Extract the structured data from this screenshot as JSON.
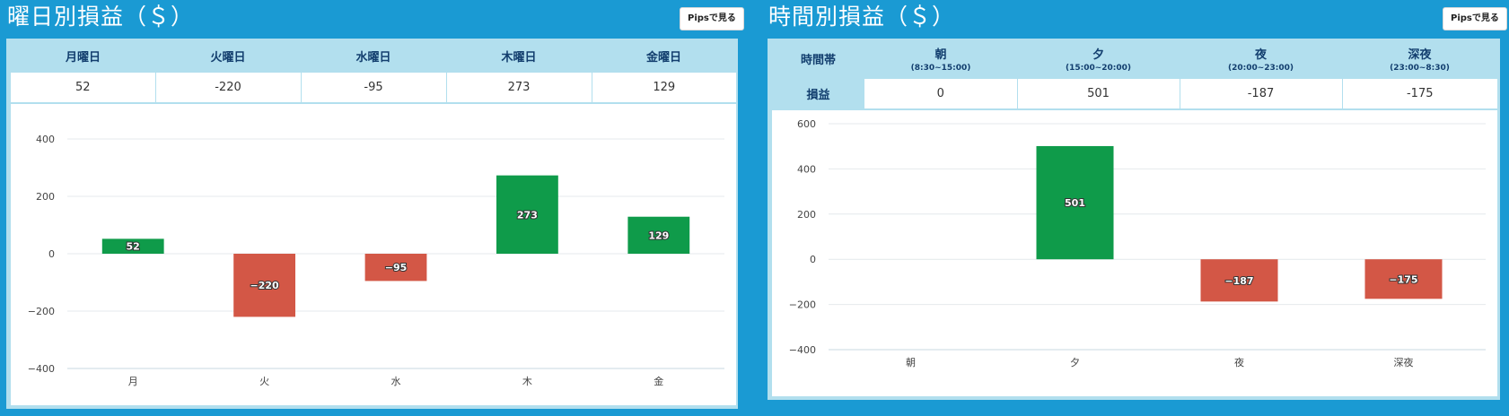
{
  "weekday": {
    "title": "曜日別損益（＄）",
    "pips_label": "Pipsで見る",
    "headers": [
      "月曜日",
      "火曜日",
      "水曜日",
      "木曜日",
      "金曜日"
    ],
    "values": [
      "52",
      "-220",
      "-95",
      "273",
      "129"
    ]
  },
  "timezone": {
    "title": "時間別損益（＄）",
    "pips_label": "Pipsで見る",
    "row_header": "時間帯",
    "row_label": "損益",
    "headers": [
      {
        "name": "朝",
        "range": "(8:30~15:00)"
      },
      {
        "name": "夕",
        "range": "(15:00~20:00)"
      },
      {
        "name": "夜",
        "range": "(20:00~23:00)"
      },
      {
        "name": "深夜",
        "range": "(23:00~8:30)"
      }
    ],
    "values": [
      "0",
      "501",
      "-187",
      "-175"
    ]
  },
  "colors": {
    "positive": "#0f9b4a",
    "negative": "#d35746"
  },
  "chart_data": [
    {
      "type": "bar",
      "categories": [
        "月",
        "火",
        "水",
        "木",
        "金"
      ],
      "values": [
        52,
        -220,
        -95,
        273,
        129
      ],
      "title": "曜日別損益（＄）",
      "xlabel": "",
      "ylabel": "",
      "ylim": [
        -400,
        400
      ],
      "yticks": [
        400,
        200,
        0,
        -200,
        -400
      ],
      "grid": true
    },
    {
      "type": "bar",
      "categories": [
        "朝",
        "夕",
        "夜",
        "深夜"
      ],
      "values": [
        0,
        501,
        -187,
        -175
      ],
      "title": "時間別損益（＄）",
      "xlabel": "",
      "ylabel": "",
      "ylim": [
        -400,
        600
      ],
      "yticks": [
        600,
        400,
        200,
        0,
        -200,
        -400
      ],
      "grid": true
    }
  ]
}
